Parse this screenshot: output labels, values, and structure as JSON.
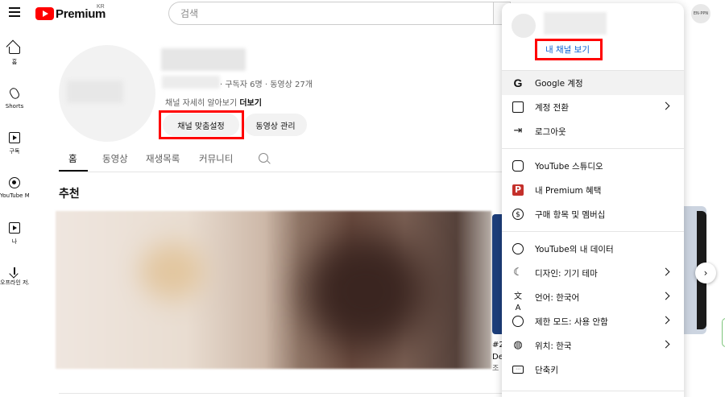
{
  "header": {
    "logo_text": "Premium",
    "region": "KR",
    "search_placeholder": "검색",
    "avatar_text": "EN·PPN"
  },
  "sidebar": {
    "items": [
      {
        "label": "홈",
        "icon": "home-icon"
      },
      {
        "label": "Shorts",
        "icon": "shorts-icon"
      },
      {
        "label": "구독",
        "icon": "subscriptions-icon"
      },
      {
        "label": "YouTube Mu...",
        "icon": "youtube-music-icon"
      },
      {
        "label": "나",
        "icon": "you-icon"
      },
      {
        "label": "오프라인 저...",
        "icon": "download-icon"
      }
    ]
  },
  "channel": {
    "meta": "· 구독자 6명 · 동영상 27개",
    "description": "채널 자세히 알아보기",
    "more_label": "더보기",
    "customize_label": "채널 맞춤설정",
    "manage_label": "동영상 관리"
  },
  "tabs": [
    {
      "label": "홈",
      "active": true
    },
    {
      "label": "동영상",
      "active": false
    },
    {
      "label": "재생목록",
      "active": false
    },
    {
      "label": "커뮤니티",
      "active": false
    }
  ],
  "content": {
    "section_title": "추천",
    "peek_line1": "#2",
    "peek_line2": "De",
    "peek_line3": "조"
  },
  "menu": {
    "view_channel": "내 채널 보기",
    "groups": [
      [
        {
          "label": "Google 계정",
          "icon": "google-icon",
          "arrow": false
        },
        {
          "label": "계정 전환",
          "icon": "switch-account-icon",
          "arrow": true
        },
        {
          "label": "로그아웃",
          "icon": "sign-out-icon",
          "arrow": false
        }
      ],
      [
        {
          "label": "YouTube 스튜디오",
          "icon": "studio-icon",
          "arrow": false
        },
        {
          "label": "내 Premium 혜택",
          "icon": "premium-icon",
          "arrow": false
        },
        {
          "label": "구매 항목 및 멤버십",
          "icon": "dollar-icon",
          "arrow": false
        }
      ],
      [
        {
          "label": "YouTube의 내 데이터",
          "icon": "data-shield-icon",
          "arrow": false
        },
        {
          "label": "디자인: 기기 테마",
          "icon": "moon-icon",
          "arrow": true
        },
        {
          "label": "언어: 한국어",
          "icon": "translate-icon",
          "arrow": true
        },
        {
          "label": "제한 모드: 사용 안함",
          "icon": "restricted-icon",
          "arrow": true
        },
        {
          "label": "위치: 한국",
          "icon": "globe-icon",
          "arrow": true
        },
        {
          "label": "단축키",
          "icon": "keyboard-icon",
          "arrow": false
        }
      ]
    ]
  },
  "colors": {
    "brand_red": "#ff0000",
    "link_blue": "#065fd4",
    "highlight": "#ff0000"
  }
}
